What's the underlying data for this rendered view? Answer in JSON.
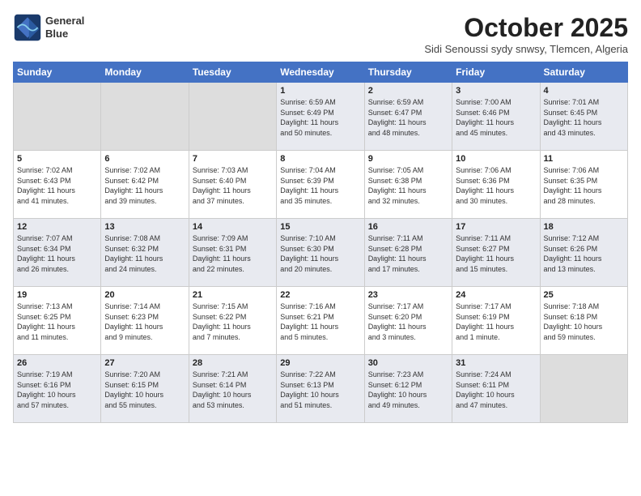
{
  "logo": {
    "line1": "General",
    "line2": "Blue"
  },
  "title": "October 2025",
  "subtitle": "Sidi Senoussi sydy snwsy, Tlemcen, Algeria",
  "weekdays": [
    "Sunday",
    "Monday",
    "Tuesday",
    "Wednesday",
    "Thursday",
    "Friday",
    "Saturday"
  ],
  "weeks": [
    [
      {
        "day": "",
        "info": ""
      },
      {
        "day": "",
        "info": ""
      },
      {
        "day": "",
        "info": ""
      },
      {
        "day": "1",
        "info": "Sunrise: 6:59 AM\nSunset: 6:49 PM\nDaylight: 11 hours\nand 50 minutes."
      },
      {
        "day": "2",
        "info": "Sunrise: 6:59 AM\nSunset: 6:47 PM\nDaylight: 11 hours\nand 48 minutes."
      },
      {
        "day": "3",
        "info": "Sunrise: 7:00 AM\nSunset: 6:46 PM\nDaylight: 11 hours\nand 45 minutes."
      },
      {
        "day": "4",
        "info": "Sunrise: 7:01 AM\nSunset: 6:45 PM\nDaylight: 11 hours\nand 43 minutes."
      }
    ],
    [
      {
        "day": "5",
        "info": "Sunrise: 7:02 AM\nSunset: 6:43 PM\nDaylight: 11 hours\nand 41 minutes."
      },
      {
        "day": "6",
        "info": "Sunrise: 7:02 AM\nSunset: 6:42 PM\nDaylight: 11 hours\nand 39 minutes."
      },
      {
        "day": "7",
        "info": "Sunrise: 7:03 AM\nSunset: 6:40 PM\nDaylight: 11 hours\nand 37 minutes."
      },
      {
        "day": "8",
        "info": "Sunrise: 7:04 AM\nSunset: 6:39 PM\nDaylight: 11 hours\nand 35 minutes."
      },
      {
        "day": "9",
        "info": "Sunrise: 7:05 AM\nSunset: 6:38 PM\nDaylight: 11 hours\nand 32 minutes."
      },
      {
        "day": "10",
        "info": "Sunrise: 7:06 AM\nSunset: 6:36 PM\nDaylight: 11 hours\nand 30 minutes."
      },
      {
        "day": "11",
        "info": "Sunrise: 7:06 AM\nSunset: 6:35 PM\nDaylight: 11 hours\nand 28 minutes."
      }
    ],
    [
      {
        "day": "12",
        "info": "Sunrise: 7:07 AM\nSunset: 6:34 PM\nDaylight: 11 hours\nand 26 minutes."
      },
      {
        "day": "13",
        "info": "Sunrise: 7:08 AM\nSunset: 6:32 PM\nDaylight: 11 hours\nand 24 minutes."
      },
      {
        "day": "14",
        "info": "Sunrise: 7:09 AM\nSunset: 6:31 PM\nDaylight: 11 hours\nand 22 minutes."
      },
      {
        "day": "15",
        "info": "Sunrise: 7:10 AM\nSunset: 6:30 PM\nDaylight: 11 hours\nand 20 minutes."
      },
      {
        "day": "16",
        "info": "Sunrise: 7:11 AM\nSunset: 6:28 PM\nDaylight: 11 hours\nand 17 minutes."
      },
      {
        "day": "17",
        "info": "Sunrise: 7:11 AM\nSunset: 6:27 PM\nDaylight: 11 hours\nand 15 minutes."
      },
      {
        "day": "18",
        "info": "Sunrise: 7:12 AM\nSunset: 6:26 PM\nDaylight: 11 hours\nand 13 minutes."
      }
    ],
    [
      {
        "day": "19",
        "info": "Sunrise: 7:13 AM\nSunset: 6:25 PM\nDaylight: 11 hours\nand 11 minutes."
      },
      {
        "day": "20",
        "info": "Sunrise: 7:14 AM\nSunset: 6:23 PM\nDaylight: 11 hours\nand 9 minutes."
      },
      {
        "day": "21",
        "info": "Sunrise: 7:15 AM\nSunset: 6:22 PM\nDaylight: 11 hours\nand 7 minutes."
      },
      {
        "day": "22",
        "info": "Sunrise: 7:16 AM\nSunset: 6:21 PM\nDaylight: 11 hours\nand 5 minutes."
      },
      {
        "day": "23",
        "info": "Sunrise: 7:17 AM\nSunset: 6:20 PM\nDaylight: 11 hours\nand 3 minutes."
      },
      {
        "day": "24",
        "info": "Sunrise: 7:17 AM\nSunset: 6:19 PM\nDaylight: 11 hours\nand 1 minute."
      },
      {
        "day": "25",
        "info": "Sunrise: 7:18 AM\nSunset: 6:18 PM\nDaylight: 10 hours\nand 59 minutes."
      }
    ],
    [
      {
        "day": "26",
        "info": "Sunrise: 7:19 AM\nSunset: 6:16 PM\nDaylight: 10 hours\nand 57 minutes."
      },
      {
        "day": "27",
        "info": "Sunrise: 7:20 AM\nSunset: 6:15 PM\nDaylight: 10 hours\nand 55 minutes."
      },
      {
        "day": "28",
        "info": "Sunrise: 7:21 AM\nSunset: 6:14 PM\nDaylight: 10 hours\nand 53 minutes."
      },
      {
        "day": "29",
        "info": "Sunrise: 7:22 AM\nSunset: 6:13 PM\nDaylight: 10 hours\nand 51 minutes."
      },
      {
        "day": "30",
        "info": "Sunrise: 7:23 AM\nSunset: 6:12 PM\nDaylight: 10 hours\nand 49 minutes."
      },
      {
        "day": "31",
        "info": "Sunrise: 7:24 AM\nSunset: 6:11 PM\nDaylight: 10 hours\nand 47 minutes."
      },
      {
        "day": "",
        "info": ""
      }
    ]
  ]
}
